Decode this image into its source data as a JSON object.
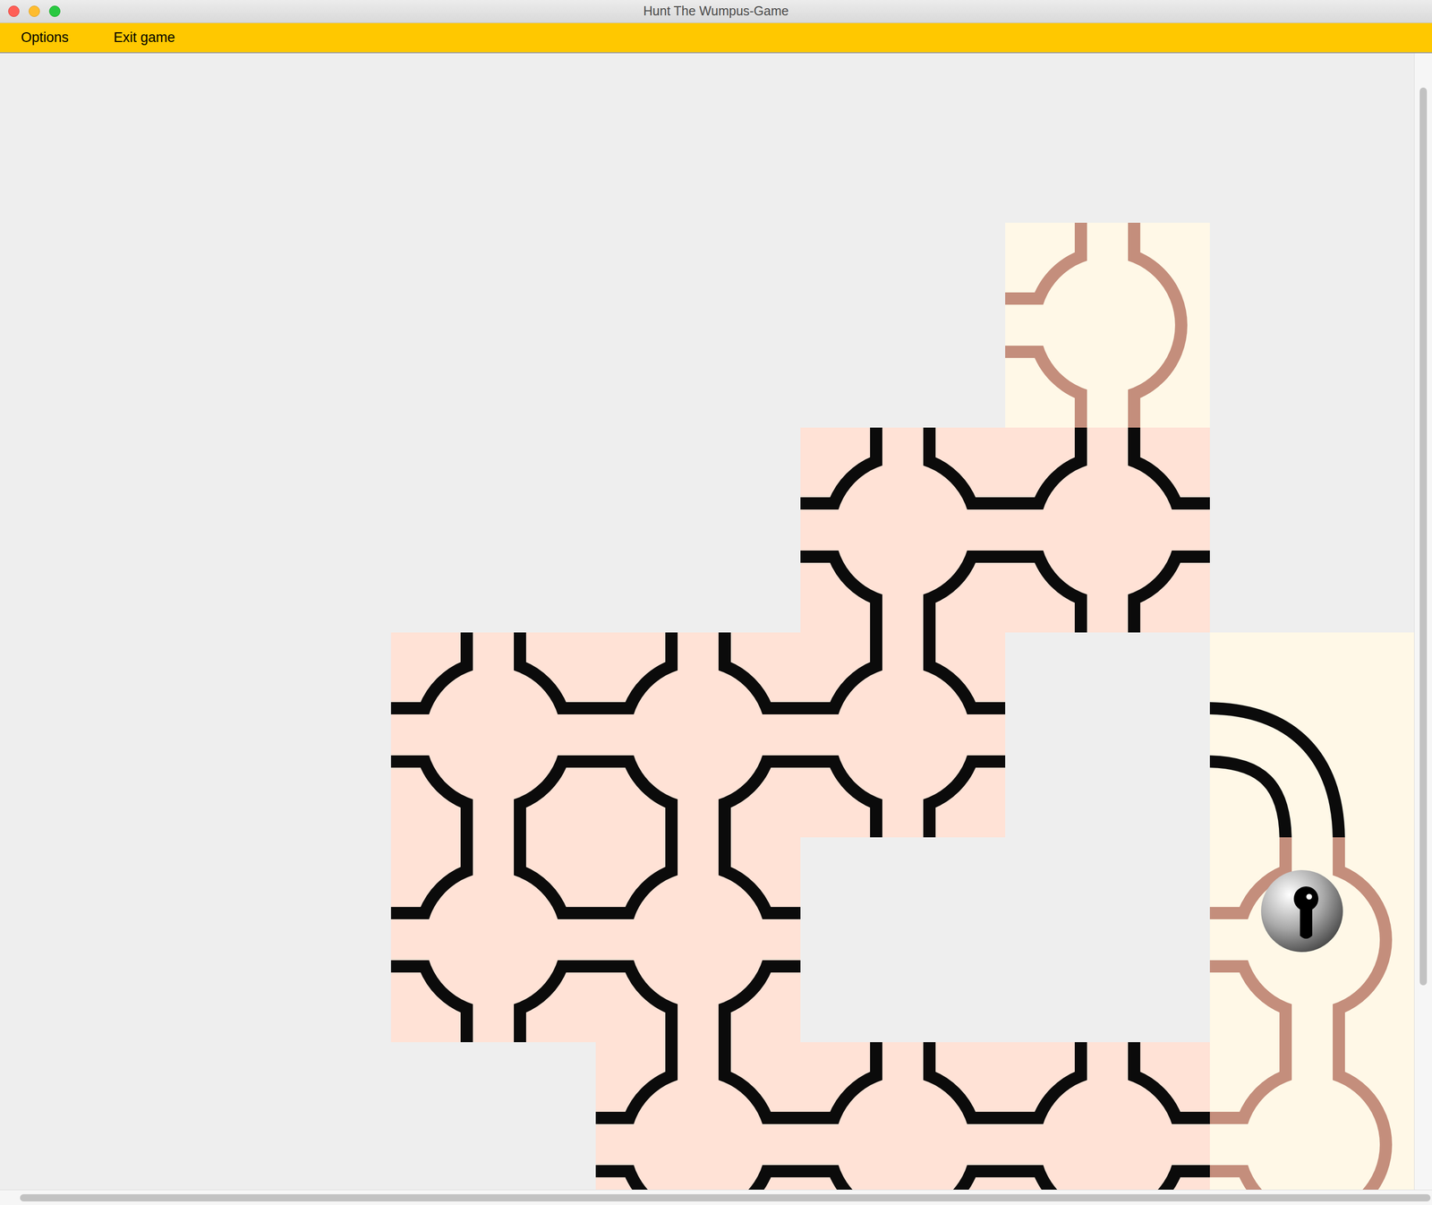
{
  "window": {
    "title": "Hunt The Wumpus-Game"
  },
  "menu": [
    "Options",
    "Exit game"
  ],
  "board": {
    "tiles": [
      {
        "row": 0,
        "col": 3,
        "kind": "room",
        "ground": "#fff8e7",
        "wall": "#c48e7c",
        "exits": [
          "up",
          "left",
          "down"
        ],
        "player": false
      },
      {
        "row": 1,
        "col": 2,
        "kind": "room",
        "ground": "#ffe2d6",
        "wall": "#0b0b0b",
        "exits": [
          "up",
          "left",
          "right",
          "down"
        ],
        "player": false
      },
      {
        "row": 1,
        "col": 3,
        "kind": "room",
        "ground": "#ffe2d6",
        "wall": "#0b0b0b",
        "exits": [
          "up",
          "left",
          "right",
          "down"
        ],
        "player": false
      },
      {
        "row": 2,
        "col": 0,
        "kind": "room",
        "ground": "#ffe2d6",
        "wall": "#0b0b0b",
        "exits": [
          "up",
          "left",
          "right",
          "down"
        ],
        "player": false
      },
      {
        "row": 2,
        "col": 1,
        "kind": "room",
        "ground": "#ffe2d6",
        "wall": "#0b0b0b",
        "exits": [
          "up",
          "left",
          "right",
          "down"
        ],
        "player": false
      },
      {
        "row": 2,
        "col": 2,
        "kind": "room",
        "ground": "#ffe2d6",
        "wall": "#0b0b0b",
        "exits": [
          "up",
          "left",
          "right",
          "down"
        ],
        "player": false
      },
      {
        "row": 2,
        "col": 4,
        "kind": "tunnel",
        "ground": "#fff8e7",
        "wall": "#0b0b0b",
        "exits": [
          "left",
          "down"
        ],
        "player": false
      },
      {
        "row": 3,
        "col": 0,
        "kind": "room",
        "ground": "#ffe2d6",
        "wall": "#0b0b0b",
        "exits": [
          "up",
          "left",
          "right",
          "down"
        ],
        "player": false
      },
      {
        "row": 3,
        "col": 1,
        "kind": "room",
        "ground": "#ffe2d6",
        "wall": "#0b0b0b",
        "exits": [
          "up",
          "left",
          "right",
          "down"
        ],
        "player": false
      },
      {
        "row": 3,
        "col": 4,
        "kind": "room",
        "ground": "#fff8e7",
        "wall": "#c48e7c",
        "exits": [
          "up",
          "left",
          "down"
        ],
        "player": true
      },
      {
        "row": 4,
        "col": 1,
        "kind": "room",
        "ground": "#ffe2d6",
        "wall": "#0b0b0b",
        "exits": [
          "up",
          "left",
          "right",
          "down"
        ],
        "player": false
      },
      {
        "row": 4,
        "col": 2,
        "kind": "room",
        "ground": "#ffe2d6",
        "wall": "#0b0b0b",
        "exits": [
          "up",
          "left",
          "right",
          "down"
        ],
        "player": false
      },
      {
        "row": 4,
        "col": 3,
        "kind": "room",
        "ground": "#ffe2d6",
        "wall": "#0b0b0b",
        "exits": [
          "up",
          "left",
          "right",
          "down"
        ],
        "player": false
      },
      {
        "row": 4,
        "col": 4,
        "kind": "room",
        "ground": "#fff8e7",
        "wall": "#c48e7c",
        "exits": [
          "up",
          "left",
          "down"
        ],
        "player": false
      }
    ]
  },
  "scrollbars": {
    "vertical": {
      "position": 0.03,
      "level": 0.79
    },
    "horizontal": {
      "position": 0.014,
      "level": 0.985
    }
  }
}
